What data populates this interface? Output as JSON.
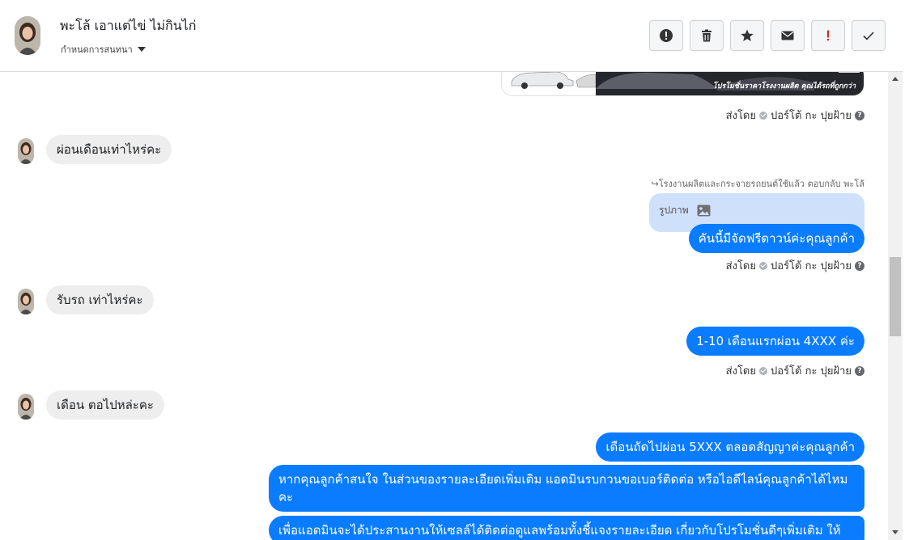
{
  "header": {
    "contact_name": "พะโล้ เอาแต่ไข่ ไม่กินไก่",
    "assign_label": "กำหนดการสนทนา",
    "toolbar": [
      {
        "name": "alert-circle-button",
        "icon": "alert-circle-icon"
      },
      {
        "name": "delete-button",
        "icon": "trash-icon"
      },
      {
        "name": "star-button",
        "icon": "star-icon"
      },
      {
        "name": "mark-unread-button",
        "icon": "envelope-icon"
      },
      {
        "name": "mark-important-button",
        "icon": "exclamation-icon",
        "color": "#e02020"
      },
      {
        "name": "mark-done-button",
        "icon": "check-icon"
      }
    ]
  },
  "image_card": {
    "promo_text": "โปรโมชั่นราคาโรงงานผลิต คุณได้รถที่ถูกกว่า"
  },
  "sent_by": {
    "prefix": "ส่งโดย",
    "sender": "ปอร์โต้ กะ ปุยฝ้าย"
  },
  "reply": {
    "note": "โรงงานผลิตและกระจายรถยนต์ใช้แล้ว ตอบกลับ พะโล้",
    "attachment_label": "รูปภาพ"
  },
  "messages": {
    "in_1": "ผ่อนเดือนเท่าไหร่คะ",
    "out_1": "คันนี้มีจัดฟรีดาวน์ค่ะคุณลูกค้า",
    "in_2": "รับรถ เท่าไหร่คะ",
    "out_2": "1-10 เดือนแรกผ่อน 4XXX ค่ะ",
    "in_3": "เดือน ตอไปหล่ะคะ",
    "out_3": "เดือนถัดไปผ่อน 5XXX ตลอดสัญญาค่ะคุณลูกค้า",
    "out_4": "หากคุณลูกค้าสนใจ ในส่วนของรายละเอียดเพิ่มเติม แอดมินรบกวนขอเบอร์ติดต่อ หรือไอดีไลน์คุณลูกค้าได้ไหมคะ",
    "out_5": "เพื่อแอดมินจะได้ประสานงานให้เซลล์ได้ติดต่อดูแลพร้อมทั้งชี้แจงรายละเอียด เกี่ยวกับโปรโมชั่นดีๆเพิ่มเติม ให้"
  },
  "colors": {
    "outgoing_bubble": "#0a7cff",
    "incoming_bubble": "#eeeeee",
    "reply_box": "#cfe0fb"
  }
}
